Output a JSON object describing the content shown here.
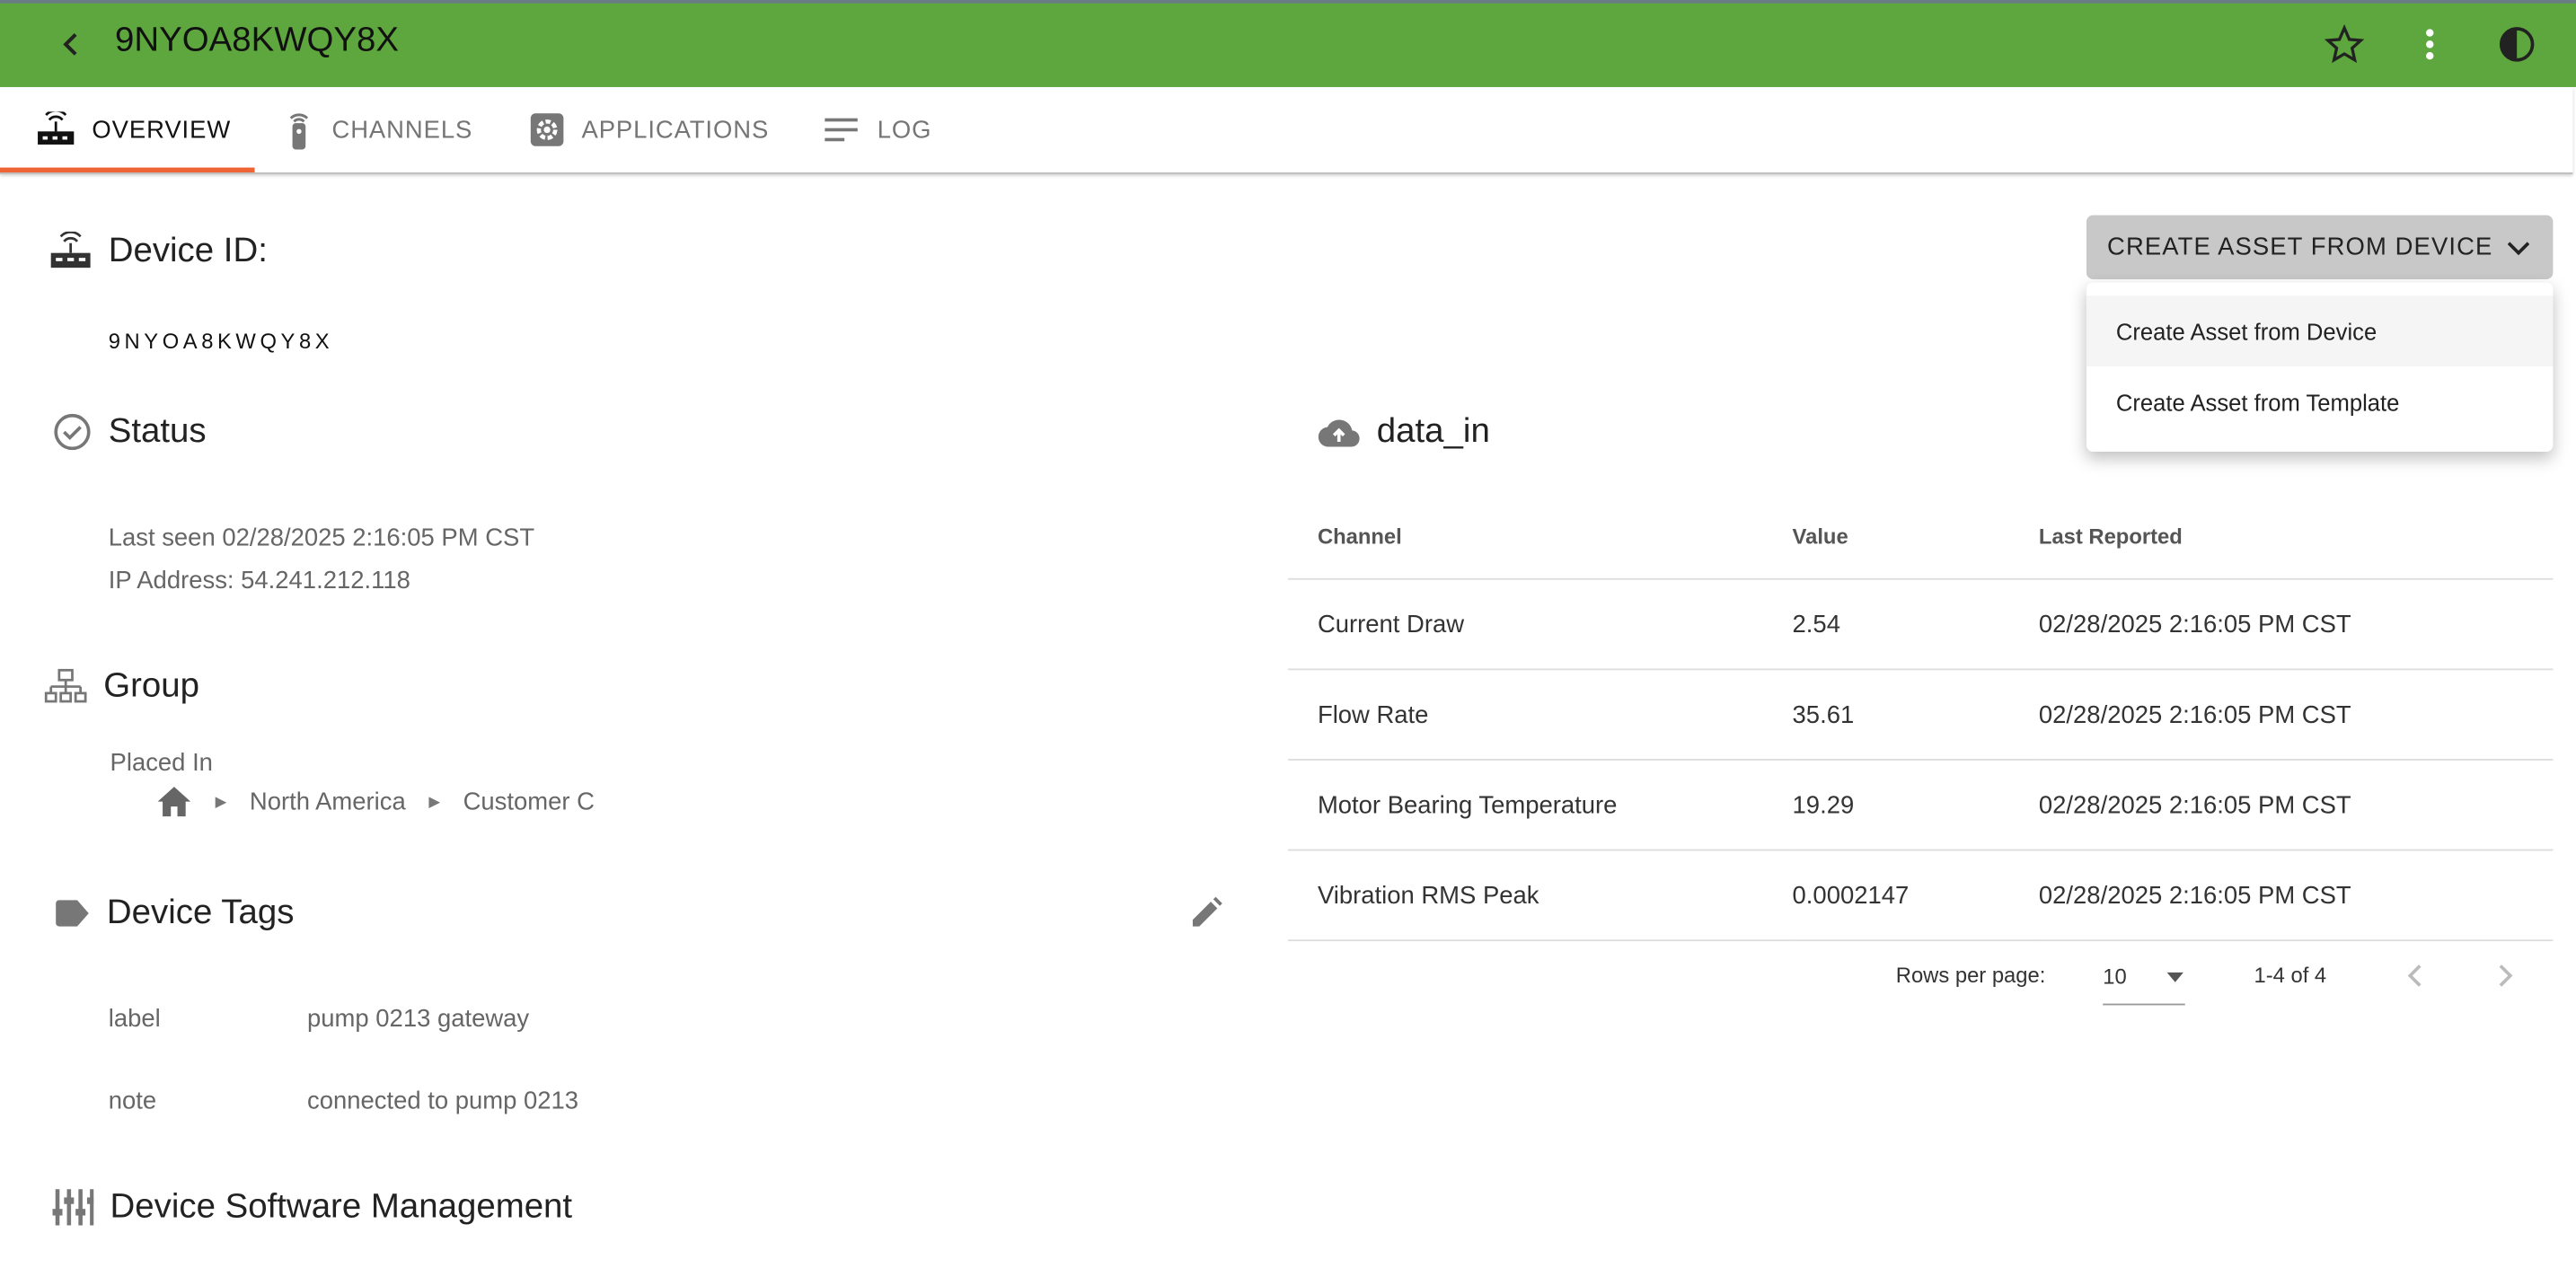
{
  "header": {
    "title": "9NYOA8KWQY8X",
    "icons": [
      "back-chevron-icon",
      "star-icon",
      "more-vert-icon",
      "contrast-icon"
    ],
    "color": "#5da73e"
  },
  "tabs": [
    {
      "label": "OVERVIEW",
      "icon": "router-icon",
      "active": true
    },
    {
      "label": "CHANNELS",
      "icon": "remote-icon"
    },
    {
      "label": "APPLICATIONS",
      "icon": "settings-app-icon"
    },
    {
      "label": "LOG",
      "icon": "list-icon"
    }
  ],
  "device": {
    "heading": "Device ID:",
    "id": "9NYOA8KWQY8X"
  },
  "status": {
    "heading": "Status",
    "last_seen": "Last seen 02/28/2025 2:16:05 PM CST",
    "ip": "IP Address: 54.241.212.118"
  },
  "group": {
    "heading": "Group",
    "placed_in": "Placed In",
    "path": [
      "North America",
      "Customer C"
    ]
  },
  "tags": {
    "heading": "Device Tags",
    "items": [
      {
        "key": "label",
        "value": "pump 0213 gateway"
      },
      {
        "key": "note",
        "value": "connected to pump 0213"
      }
    ]
  },
  "software": {
    "heading": "Device Software Management"
  },
  "create_button": {
    "label": "CREATE ASSET FROM DEVICE",
    "menu": [
      "Create Asset from Device",
      "Create Asset from Template"
    ]
  },
  "data_in": {
    "heading": "data_in",
    "columns": [
      "Channel",
      "Value",
      "Last Reported"
    ],
    "rows": [
      [
        "Current Draw",
        "2.54",
        "02/28/2025 2:16:05 PM CST"
      ],
      [
        "Flow Rate",
        "35.61",
        "02/28/2025 2:16:05 PM CST"
      ],
      [
        "Motor Bearing Temperature",
        "19.29",
        "02/28/2025 2:16:05 PM CST"
      ],
      [
        "Vibration RMS Peak",
        "0.0002147",
        "02/28/2025 2:16:05 PM CST"
      ]
    ],
    "rows_per_page_label": "Rows per page:",
    "rows_per_page": "10",
    "range": "1-4 of 4"
  }
}
